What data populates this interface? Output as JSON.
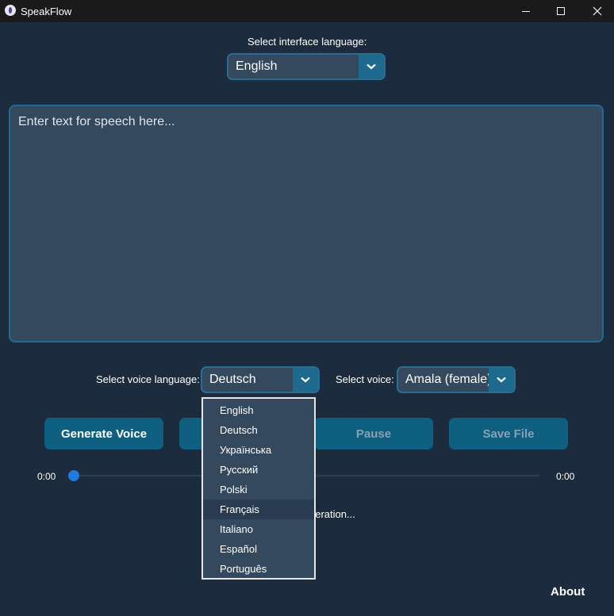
{
  "window": {
    "title": "SpeakFlow"
  },
  "interface_language": {
    "label": "Select interface language:",
    "value": "English"
  },
  "text_input": {
    "placeholder": "Enter text for speech here..."
  },
  "voice_language": {
    "label": "Select voice language:",
    "value": "Deutsch"
  },
  "voice": {
    "label": "Select voice:",
    "value": "Amala (female)"
  },
  "buttons": {
    "generate": "Generate Voice",
    "pause": "Pause",
    "save": "Save File"
  },
  "player": {
    "current_time": "0:00",
    "total_time": "0:00",
    "progress": 0
  },
  "status": {
    "text": "neration..."
  },
  "about": "About",
  "dropdown": {
    "options": [
      "English",
      "Deutsch",
      "Українська",
      "Русский",
      "Polski",
      "Français",
      "Italiano",
      "Español",
      "Português"
    ],
    "highlighted": "Français"
  },
  "colors": {
    "background": "#1c2b3e",
    "accent": "#0f5f80",
    "slider": "#1f7ae0"
  }
}
